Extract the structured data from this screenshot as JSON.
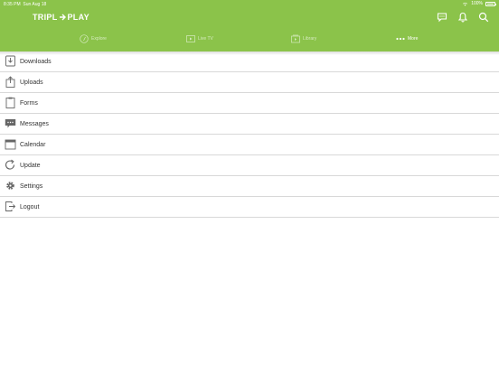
{
  "status_bar": {
    "time": "8:35 PM",
    "date": "Sun Aug 18",
    "battery": "100%",
    "battery_level": 1.0
  },
  "app": {
    "logo_text_left": "TRIPL",
    "logo_text_right": "PLAY"
  },
  "tabs": [
    {
      "label": "Explore",
      "icon": "compass-icon",
      "active": false
    },
    {
      "label": "Live TV",
      "icon": "tv-play-icon",
      "active": false
    },
    {
      "label": "Library",
      "icon": "library-icon",
      "active": false
    },
    {
      "label": "More",
      "icon": "more-dots-icon",
      "active": true
    }
  ],
  "menu": [
    {
      "label": "Downloads",
      "icon": "download-icon"
    },
    {
      "label": "Uploads",
      "icon": "upload-icon"
    },
    {
      "label": "Forms",
      "icon": "clipboard-icon"
    },
    {
      "label": "Messages",
      "icon": "message-icon"
    },
    {
      "label": "Calendar",
      "icon": "calendar-icon"
    },
    {
      "label": "Update",
      "icon": "refresh-icon"
    },
    {
      "label": "Settings",
      "icon": "gear-icon"
    },
    {
      "label": "Logout",
      "icon": "logout-icon"
    }
  ],
  "colors": {
    "brand_green": "#8bc34a",
    "divider": "#d8d8d8",
    "icon_gray": "#666666"
  }
}
